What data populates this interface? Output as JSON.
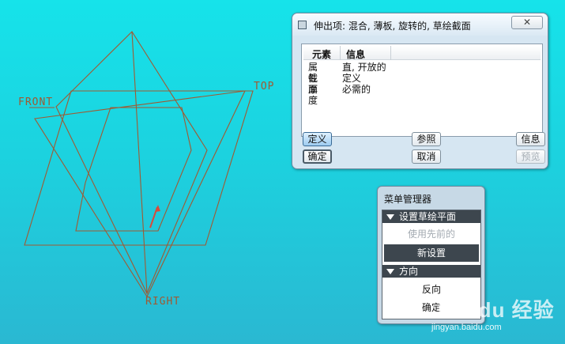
{
  "colors": {
    "plane_lines": "#a05a32",
    "arrow": "#d84b3a",
    "dialog_bg": "#d6e6f2",
    "menu_section_bg": "#3d464e"
  },
  "viewport": {
    "datum_planes": {
      "front": "FRONT",
      "top": "TOP",
      "right": "RIGHT"
    },
    "direction_arrow_icon": "arrow-up-right-icon"
  },
  "element_dialog": {
    "title": "伸出项: 混合, 薄板, 旋转的, 草绘截面",
    "close_label": "",
    "table": {
      "columns": [
        "元素",
        "信息"
      ],
      "rows": [
        [
          "属性",
          "直, 开放的"
        ],
        [
          "截面",
          "定义"
        ],
        [
          "厚度",
          "必需的"
        ]
      ]
    },
    "buttons": {
      "define": "定义",
      "reference": "参照",
      "info": "信息",
      "ok": "确定",
      "cancel": "取消",
      "preview": "预览"
    }
  },
  "menu_manager": {
    "title": "菜单管理器",
    "sections": [
      {
        "label": "设置草绘平面",
        "items": [
          {
            "label": "使用先前的",
            "state": "disabled"
          },
          {
            "label": "新设置",
            "state": "selected"
          }
        ]
      },
      {
        "label": "方向",
        "items": [
          {
            "label": "反向",
            "state": "normal"
          },
          {
            "label": "确定",
            "state": "normal"
          }
        ]
      }
    ]
  },
  "watermark": {
    "main": "Bai du 经验",
    "sub": "jingyan.baidu.com"
  }
}
